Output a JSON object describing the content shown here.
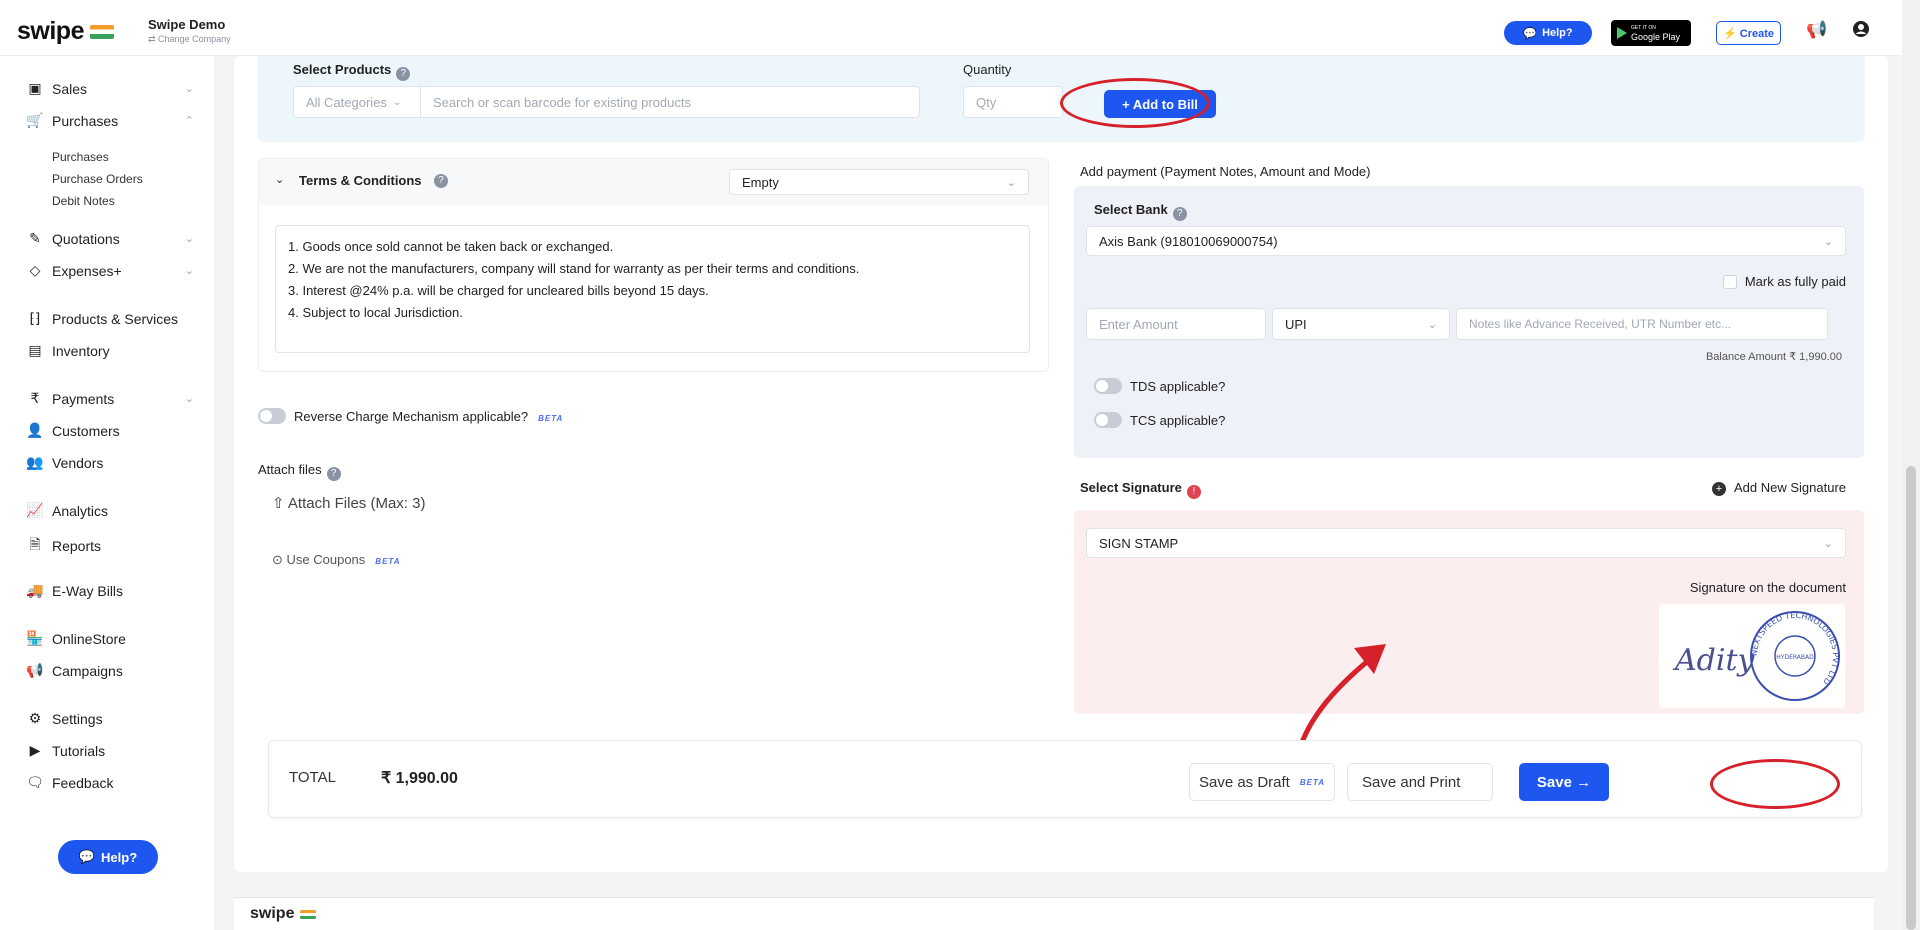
{
  "app": {
    "logo": "swipe",
    "company_name": "Swipe Demo",
    "company_change": "⇄ Change Company"
  },
  "topbar": {
    "help": "Help?",
    "gplay_small": "GET IT ON",
    "gplay": "Google Play",
    "create": "⚡ Create"
  },
  "sidebar": {
    "items": [
      {
        "label": "Sales"
      },
      {
        "label": "Purchases"
      },
      {
        "label": "Quotations"
      },
      {
        "label": "Expenses+"
      },
      {
        "label": "Products & Services"
      },
      {
        "label": "Inventory"
      },
      {
        "label": "Payments"
      },
      {
        "label": "Customers"
      },
      {
        "label": "Vendors"
      },
      {
        "label": "Analytics"
      },
      {
        "label": "Reports"
      },
      {
        "label": "E-Way Bills"
      },
      {
        "label": "OnlineStore"
      },
      {
        "label": "Campaigns"
      },
      {
        "label": "Settings"
      },
      {
        "label": "Tutorials"
      },
      {
        "label": "Feedback"
      }
    ],
    "sub_items": [
      "Purchases",
      "Purchase Orders",
      "Debit Notes"
    ],
    "help": "Help?"
  },
  "products": {
    "label": "Select Products",
    "category": "All Categories",
    "search_placeholder": "Search or scan barcode for existing products",
    "quantity_label": "Quantity",
    "qty_placeholder": "Qty",
    "add_to_bill": "+ Add to Bill"
  },
  "terms": {
    "label": "Terms & Conditions",
    "template": "Empty",
    "lines": [
      "1. Goods once sold cannot be taken back or exchanged.",
      "2. We are not the manufacturers, company will stand for warranty as per their terms and conditions.",
      "3. Interest @24% p.a. will be charged for uncleared bills beyond 15 days.",
      "4. Subject to local Jurisdiction."
    ]
  },
  "reverse_charge": {
    "label": "Reverse Charge Mechanism applicable?",
    "badge": "BETA"
  },
  "attach": {
    "label": "Attach files",
    "button": "Attach Files (Max: 3)"
  },
  "coupons": {
    "label": "Use Coupons",
    "badge": "BETA"
  },
  "payment": {
    "title": "Add payment (Payment Notes, Amount and Mode)",
    "bank_label": "Select Bank",
    "bank_value": "Axis Bank (918010069000754)",
    "mark_paid": "Mark as fully paid",
    "amount_placeholder": "Enter Amount",
    "mode": "UPI",
    "notes_placeholder": "Notes like Advance Received, UTR Number etc...",
    "balance": "Balance Amount  ₹ 1,990.00",
    "tds": "TDS applicable?",
    "tcs": "TCS applicable?"
  },
  "signature": {
    "label": "Select Signature",
    "add_new": "Add New Signature",
    "value": "SIGN STAMP",
    "on_document": "Signature on the document",
    "stamp_ring_text": "NEXTSPEED TECHNOLOGIES PVT LTD",
    "stamp_center": "HYDERABAD",
    "handwriting": "Adity"
  },
  "totals": {
    "label": "TOTAL",
    "amount": "₹ 1,990.00",
    "save_draft": "Save as Draft",
    "draft_badge": "BETA",
    "save_print": "Save and Print",
    "save": "Save →"
  },
  "footer": {
    "logo": "swipe"
  },
  "colors": {
    "primary": "#1e56f0",
    "annotation": "#d6202a",
    "payment_bg": "#eef1f8",
    "signature_bg": "#fcedef",
    "product_bg": "#edf6fa"
  }
}
